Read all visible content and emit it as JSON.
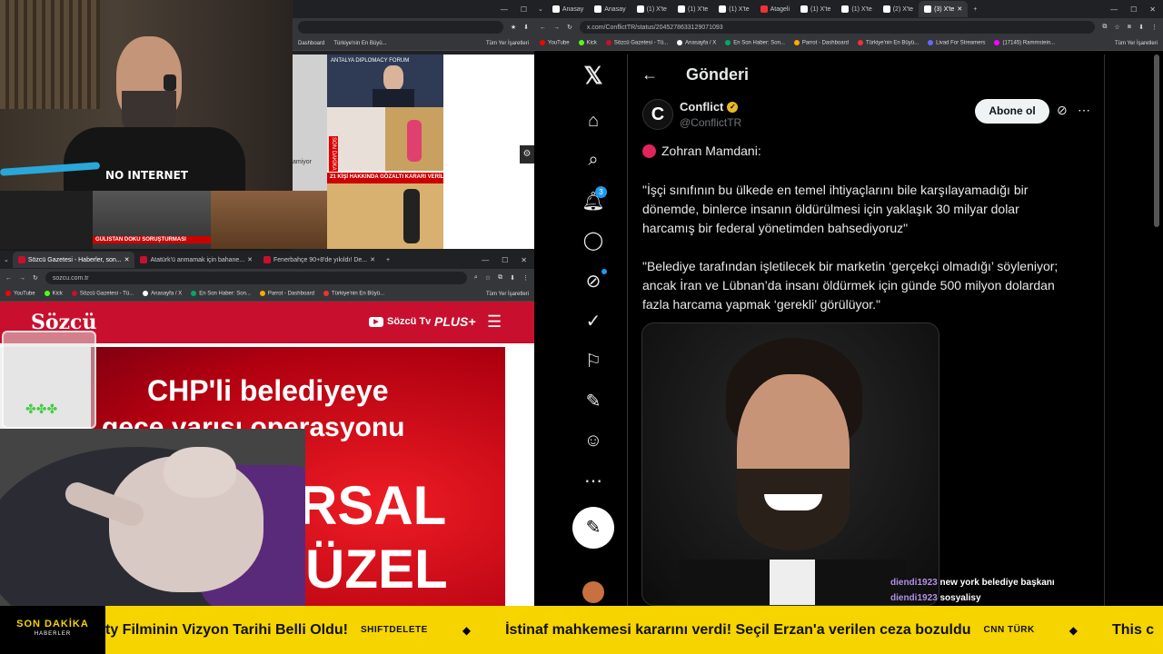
{
  "webcam": {
    "shirt_text": "NO INTERNET"
  },
  "browser_top": {
    "bookmarks": [
      "Dashboard",
      "Türkiye'nin En Büyü...",
      "Tüm Yer İşaretleri"
    ]
  },
  "news_collage": {
    "forum_text": "ANTALYA DIPLOMACY FORUM",
    "headline_left": "GÜLİSTAN DOKU SORUŞTURMASI",
    "headline_right": "21 KİŞİ HAKKINDA GÖZALTI KARARI VERİLDİ",
    "caption": "amiyor",
    "son_dakika": "SON DAKİKA"
  },
  "browser_sozcu": {
    "tabs": [
      {
        "label": "Sözcü Gazetesi - Haberler, son...",
        "active": true
      },
      {
        "label": "Atatürk'ü anmamak için bahane...",
        "active": false
      },
      {
        "label": "Fenerbahçe 90+8'de yıkıldı! De...",
        "active": false
      }
    ],
    "url": "sozcu.com.tr",
    "bookmarks": [
      "YouTube",
      "Kick",
      "Sözcü Gazetesi - Tü...",
      "Anasayfa / X",
      "En Son Haber: Son...",
      "Parrot - Dashboard",
      "Türkiye'nin En Büyü...",
      "Tüm Yer İşaretleri"
    ]
  },
  "sozcu": {
    "logo": "Sözcü",
    "tv": "Sözcü Tv",
    "plus": "PLUS+",
    "headline1": "CHP'li belediyeye",
    "headline2": "gece yarısı operasyonu",
    "big1": "RSAL",
    "big2": "ÜZEL"
  },
  "x_browser": {
    "tabs": [
      "Anasay",
      "Anasay",
      "(1) X'te",
      "(1) X'te",
      "(1) X'te",
      "Atageli",
      "(1) X'te",
      "(1) X'te",
      "(2) X'te",
      "(3) X'te"
    ],
    "url": "x.com/ConflictTR/status/2045278633129071093",
    "bookmarks": [
      "YouTube",
      "Kick",
      "Sözcü Gazetesi - Tü...",
      "Anasayfa / X",
      "En Son Haber: Son...",
      "Parrot - Dashboard",
      "Türkiye'nin En Büyü...",
      "Livad For Streamers",
      "(17145) Rammstein...",
      "Tüm Yer İşaretleri"
    ]
  },
  "x": {
    "header": "Gönderi",
    "notif_count": "3",
    "author_name": "Conflict",
    "author_handle": "@ConflictTR",
    "follow": "Abone ol",
    "avatar_letter": "C",
    "line1": "Zohran Mamdani:",
    "para1": "\"İşçi sınıfının bu ülkede en temel ihtiyaçlarını bile karşılayamadığı bir dönemde, binlerce insanın öldürülmesi için yaklaşık 30 milyar dolar harcamış bir federal yönetimden bahsediyoruz\"",
    "para2": "\"Belediye tarafından işletilecek bir marketin ‘gerçekçi olmadığı’ söyleniyor; ancak İran ve Lübnan’da insanı öldürmek için günde 500 milyon dolardan fazla harcama yapmak ‘gerekli’ görülüyor.\""
  },
  "chat": [
    {
      "user": "diendi1923",
      "msg": "new york belediye başkanı"
    },
    {
      "user": "diendi1923",
      "msg": "sosyalisy"
    }
  ],
  "ticker": {
    "brand1": "SON DAKİKA",
    "brand2": "HABERLER",
    "items": [
      {
        "text": "ty Filminin Vizyon Tarihi Belli Oldu!",
        "source": "SHIFTDELETE"
      },
      {
        "text": "İstinaf mahkemesi kararını verdi! Seçil Erzan'a verilen ceza bozuldu",
        "source": "CNN TÜRK"
      },
      {
        "text": "This c",
        "source": ""
      }
    ]
  },
  "colors": {
    "x_bg": "#000000",
    "twitter_blue": "#1d9bf0",
    "sozcu_red": "#c8102e",
    "ticker_yellow": "#f5d400"
  }
}
